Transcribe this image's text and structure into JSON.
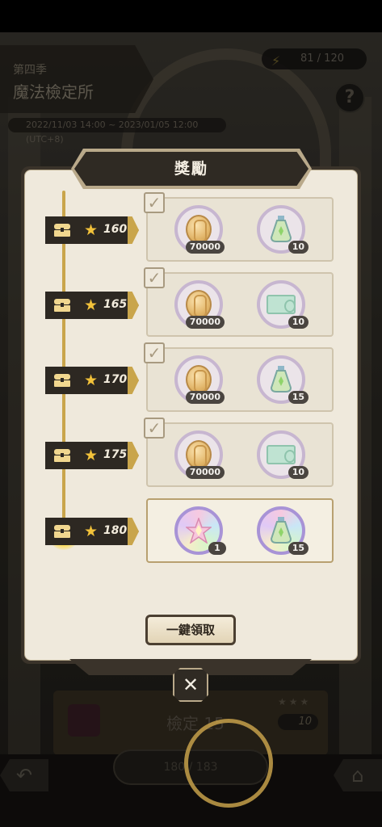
{
  "background": {
    "season_label": "第四季",
    "season_title": "魔法檢定所",
    "date_range": "2022/11/03 14:00 ~ 2023/01/05 12:00 (UTC+8)",
    "energy": "81 / 120",
    "help_label": "?",
    "bottom_title": "檢定 15",
    "bottom_cost": "10",
    "progress": "180 / 183"
  },
  "panel": {
    "title": "獎勵",
    "claim_all_label": "一鍵領取",
    "close_label": "✕"
  },
  "tiers": [
    {
      "stars": "160",
      "claimed": true,
      "items": [
        {
          "type": "coin",
          "qty": "70000"
        },
        {
          "type": "potion",
          "qty": "10"
        }
      ]
    },
    {
      "stars": "165",
      "claimed": true,
      "items": [
        {
          "type": "coin",
          "qty": "70000"
        },
        {
          "type": "ticket",
          "qty": "10"
        }
      ]
    },
    {
      "stars": "170",
      "claimed": true,
      "items": [
        {
          "type": "coin",
          "qty": "70000"
        },
        {
          "type": "potion",
          "qty": "15"
        }
      ]
    },
    {
      "stars": "175",
      "claimed": true,
      "items": [
        {
          "type": "coin",
          "qty": "70000"
        },
        {
          "type": "ticket",
          "qty": "10"
        }
      ]
    },
    {
      "stars": "180",
      "claimed": false,
      "items": [
        {
          "type": "star-gem",
          "qty": "1"
        },
        {
          "type": "potion-rainbow",
          "qty": "15"
        }
      ]
    }
  ],
  "colors": {
    "accent_gold": "#c9a54b",
    "panel_dark": "#2f2a23",
    "panel_light": "#efe9dc",
    "star": "#f2c23a"
  }
}
